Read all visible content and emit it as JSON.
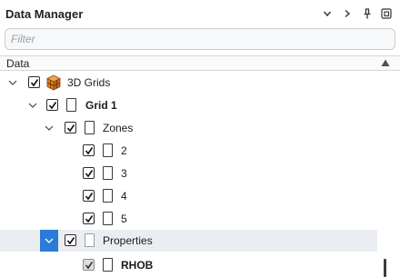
{
  "panel": {
    "title": "Data Manager",
    "filter_placeholder": "Filter",
    "column_header": "Data"
  },
  "titlebar_icons": [
    "chevron-down-icon",
    "chevron-right-icon",
    "pin-icon",
    "float-window-icon"
  ],
  "tree": [
    {
      "label": "3D Grids",
      "level": 0,
      "expanded": true,
      "checked": true,
      "icon": "3d-grid-icon",
      "bold": false
    },
    {
      "label": "Grid 1",
      "level": 1,
      "expanded": true,
      "checked": true,
      "icon": "grid-icon",
      "bold": true
    },
    {
      "label": "Zones",
      "level": 2,
      "expanded": true,
      "checked": true,
      "icon": "folder-icon",
      "bold": false
    },
    {
      "label": "2",
      "level": 3,
      "checked": true,
      "icon": "zone-icon",
      "bold": false
    },
    {
      "label": "3",
      "level": 3,
      "checked": true,
      "icon": "zone-icon",
      "bold": false
    },
    {
      "label": "4",
      "level": 3,
      "checked": true,
      "icon": "zone-icon",
      "bold": false
    },
    {
      "label": "5",
      "level": 3,
      "checked": true,
      "icon": "zone-icon",
      "bold": false
    },
    {
      "label": "Properties",
      "level": 2,
      "expanded": true,
      "checked": true,
      "icon": "folder-icon",
      "bold": false,
      "selected": true
    },
    {
      "label": "RHOB",
      "level": 3,
      "checked": true,
      "icon": "property-icon",
      "bold": true
    }
  ],
  "colors": {
    "selection": "#2b7bd8",
    "row_highlight": "#eaedf1",
    "grid_icon_orange": "#e07a1f"
  }
}
